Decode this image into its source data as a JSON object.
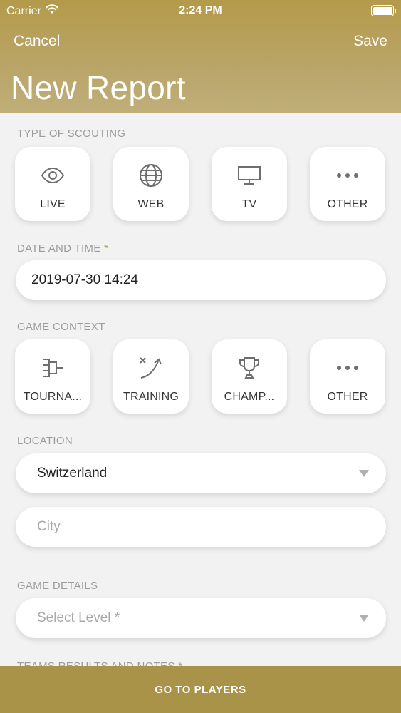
{
  "status": {
    "carrier": "Carrier",
    "time": "2:24 PM",
    "icons": [
      "wifi-icon",
      "battery-icon"
    ]
  },
  "nav": {
    "cancel": "Cancel",
    "save": "Save",
    "title": "New Report"
  },
  "scouting": {
    "label": "TYPE OF SCOUTING",
    "options": [
      {
        "label": "LIVE",
        "icon": "eye-icon"
      },
      {
        "label": "WEB",
        "icon": "globe-icon"
      },
      {
        "label": "TV",
        "icon": "tv-icon"
      },
      {
        "label": "OTHER",
        "icon": "more-dots-icon"
      }
    ]
  },
  "date": {
    "label": "DATE AND TIME",
    "required": "*",
    "value": "2019-07-30 14:24"
  },
  "context": {
    "label": "GAME CONTEXT",
    "options": [
      {
        "label": "TOURNA...",
        "icon": "bracket-icon"
      },
      {
        "label": "TRAINING",
        "icon": "tactics-icon"
      },
      {
        "label": "CHAMP...",
        "icon": "trophy-icon"
      },
      {
        "label": "OTHER",
        "icon": "more-dots-icon"
      }
    ]
  },
  "location": {
    "label": "LOCATION",
    "country": "Switzerland",
    "city_placeholder": "City"
  },
  "game_details": {
    "label": "GAME DETAILS",
    "level_placeholder": "Select Level *"
  },
  "teams": {
    "label": "TEAMS RESULTS AND NOTES *"
  },
  "footer": {
    "button": "GO TO PLAYERS"
  },
  "colors": {
    "accent": "#b49a4a",
    "footer": "#a99349",
    "background": "#f2f2f2"
  }
}
